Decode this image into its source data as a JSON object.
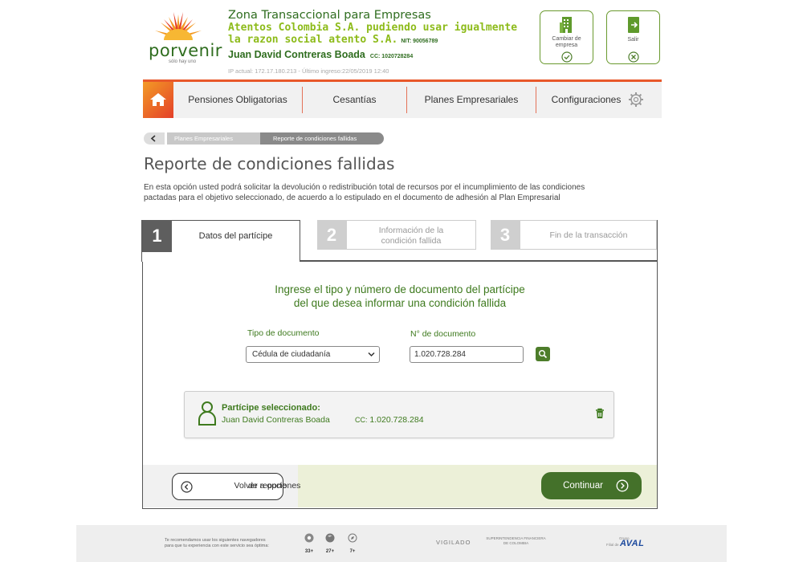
{
  "brand": {
    "name": "porvenir",
    "tagline": "sólo hay uno",
    "sun_color": "#f39a25",
    "green": "#2f6d1f"
  },
  "header": {
    "zone": "Zona Transaccional para Empresas",
    "company_line1": "Atentos Colombia S.A. pudiendo usar igualmente",
    "company_line2": "la razon social atento S.A.",
    "nit": "NIT: 90056789",
    "user_name": "Juan David Contreras Boada",
    "user_cc": "CC: 1020728284",
    "ip_info": "IP actual: 172.17.180.213 - Último ingreso:22/05/2019 12:40",
    "change_company_label": "Cambiar de empresa",
    "exit_label": "Salir"
  },
  "nav": {
    "items": [
      {
        "label": "Pensiones Obligatorias"
      },
      {
        "label": "Cesantías"
      },
      {
        "label": "Planes Empresariales"
      },
      {
        "label": "Configuraciones"
      }
    ]
  },
  "breadcrumb": {
    "items": [
      "Planes Empresariales",
      "Reporte de condiciones fallidas"
    ]
  },
  "page": {
    "title": "Reporte de condiciones fallidas",
    "description_line1": "En esta opción usted podrá solicitar la devolución o redistribución total de recursos por el incumplimiento de las condiciones",
    "description_line2": "pactadas para el objetivo seleccionado, de acuerdo a lo estipulado en el documento de adhesión al Plan Empresarial"
  },
  "steps": [
    {
      "number": "1",
      "label": "Datos del partícipe"
    },
    {
      "number": "2",
      "label_line1": "Información de la",
      "label_line2": "condición fallida"
    },
    {
      "number": "3",
      "label": "Fin de la transacción"
    }
  ],
  "form": {
    "prompt_line1": "Ingrese el tipo y número de documento del partícipe",
    "prompt_line2": "del que desea informar una condición fallida",
    "doc_type_label": "Tipo de documento",
    "doc_type_value": "Cédula de ciudadanía",
    "doc_number_label": "N° de documento",
    "doc_number_value": "1.020.728.284"
  },
  "selected": {
    "title": "Partícipe seleccionado:",
    "name": "Juan David Contreras Boada",
    "cc_label": "CC:",
    "cc_value": "1.020.728.284"
  },
  "actions": {
    "back_line1": "Volver a opciones",
    "back_line2": "de reporte",
    "continue": "Continuar"
  },
  "footer": {
    "recommend_line1": "Te recomendamos usar los siguientes navegadores",
    "recommend_line2": "para que tu experiencia con este servicio sea óptima:",
    "browsers": [
      {
        "icon": "chrome-icon",
        "version": "33+"
      },
      {
        "icon": "firefox-icon",
        "version": "27+"
      },
      {
        "icon": "safari-icon",
        "version": "7+"
      }
    ],
    "vigilado": "VIGILADO",
    "superintendencia_line1": "SUPERINTENDENCIA FINANCIERA",
    "superintendencia_line2": "DE COLOMBIA",
    "grupo": "Grupo",
    "filial": "Filial de",
    "aval": "AVAL"
  }
}
